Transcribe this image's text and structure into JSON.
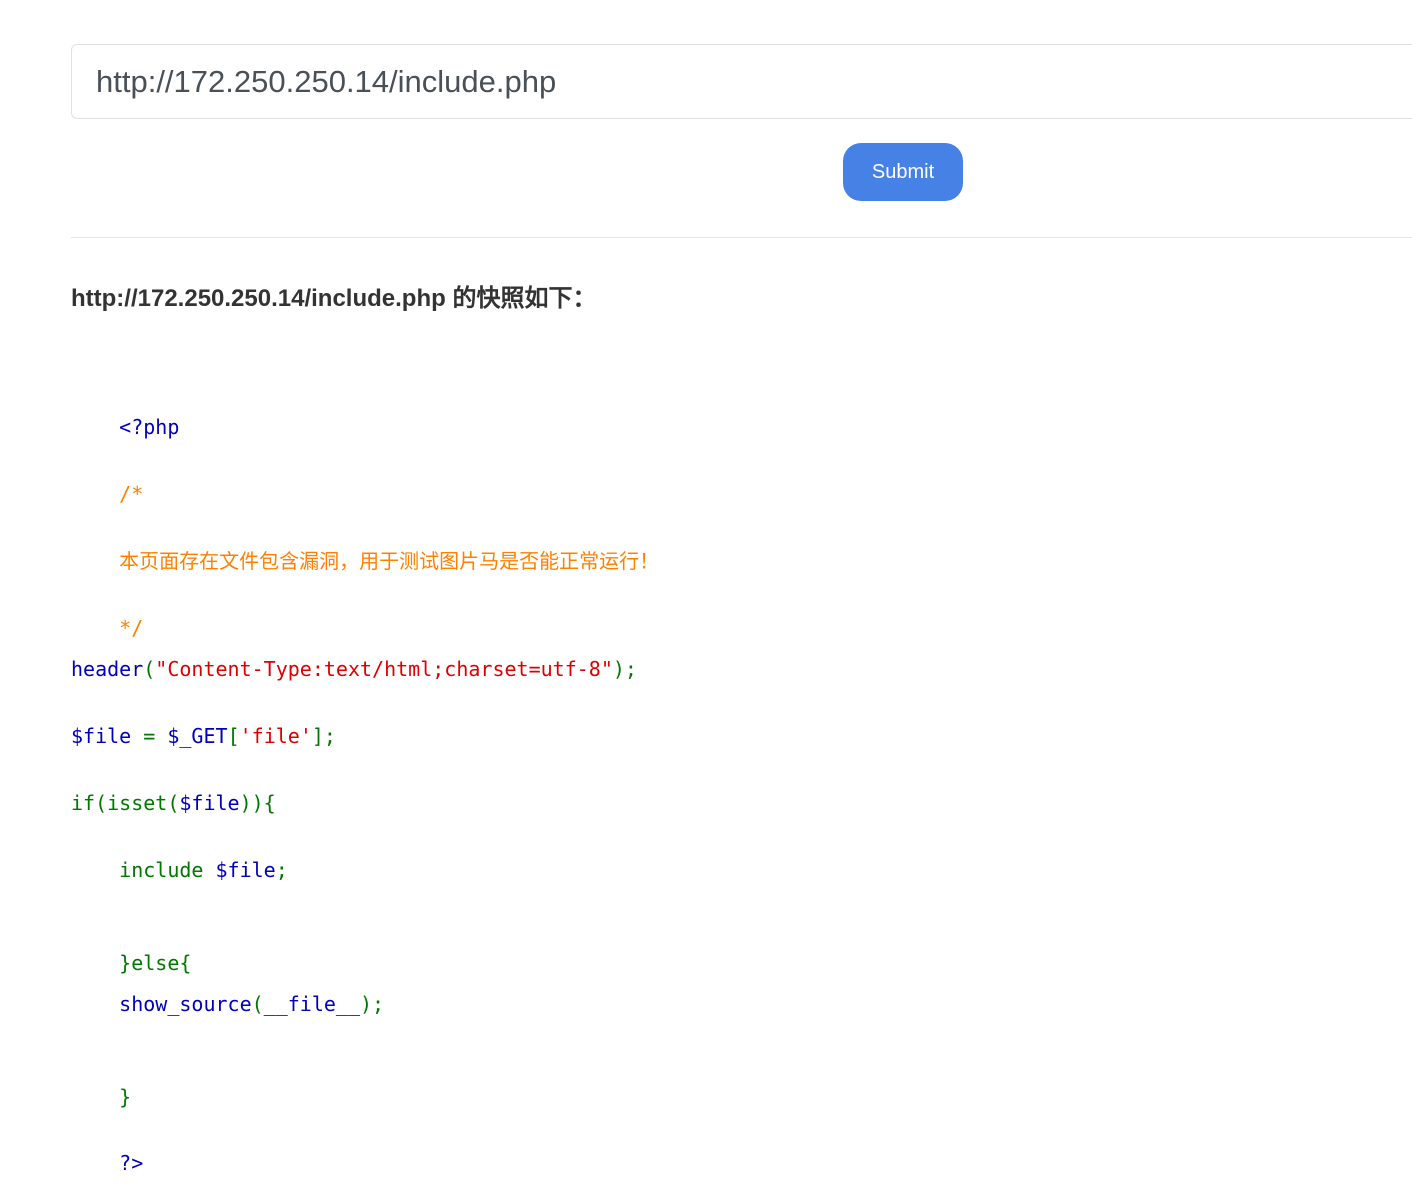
{
  "form": {
    "url_value": "http://172.250.250.14/include.php",
    "submit_label": "Submit"
  },
  "snapshot": {
    "heading": "http://172.250.250.14/include.php 的快照如下："
  },
  "code": {
    "open_tag": "<?php",
    "comment_start": "/*",
    "comment_text": "本页面存在文件包含漏洞，用于测试图片马是否能正常运行！",
    "comment_end": "*/",
    "line_header_fn": "header",
    "line_header_open": "(",
    "line_header_str": "\"Content-Type:text/html;charset=utf-8\"",
    "line_header_close": ");",
    "line_file_var": "$file ",
    "line_file_eq": "= ",
    "line_file_get": "$_GET",
    "line_file_bracket_open": "[",
    "line_file_key": "'file'",
    "line_file_bracket_close": "];",
    "line_if_open": "if(isset(",
    "line_if_var": "$file",
    "line_if_close": ")){",
    "line_include_kw": "    include ",
    "line_include_var": "$file",
    "line_include_semi": ";",
    "line_else": "}else{",
    "line_show_fn": "    show_source",
    "line_show_open": "(",
    "line_show_arg": "__file__",
    "line_show_close": ");",
    "line_close_brace": "}",
    "close_tag": "?>"
  },
  "colors": {
    "button_bg": "#4682e6",
    "code_default": "#0000bb",
    "code_keyword": "#007700",
    "code_comment": "#ff8000",
    "code_string": "#dd0000"
  }
}
